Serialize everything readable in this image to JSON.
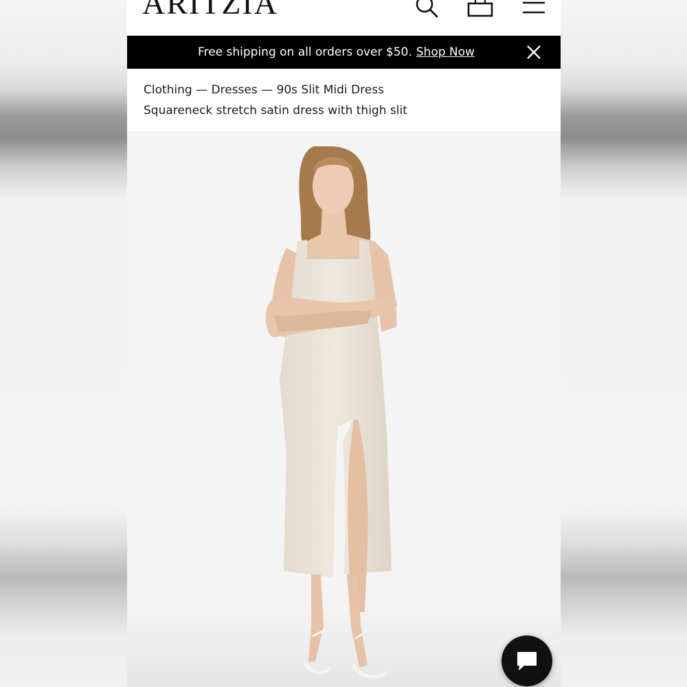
{
  "header": {
    "logo": "ARITZIA",
    "icons": [
      "search-icon",
      "bag-icon",
      "menu-icon"
    ]
  },
  "banner": {
    "message": "Free shipping on all orders over $50.",
    "link_label": "Shop Now"
  },
  "breadcrumb": {
    "path": "Clothing — Dresses — 90s Slit Midi Dress",
    "description": "Squareneck stretch satin dress with thigh slit"
  },
  "product_image": {
    "subject": "model-wearing-dress",
    "colors": {
      "dress": "#ece5da",
      "background": "#f4f4f4"
    }
  },
  "chat": {
    "icon": "chat-bubble-icon"
  }
}
